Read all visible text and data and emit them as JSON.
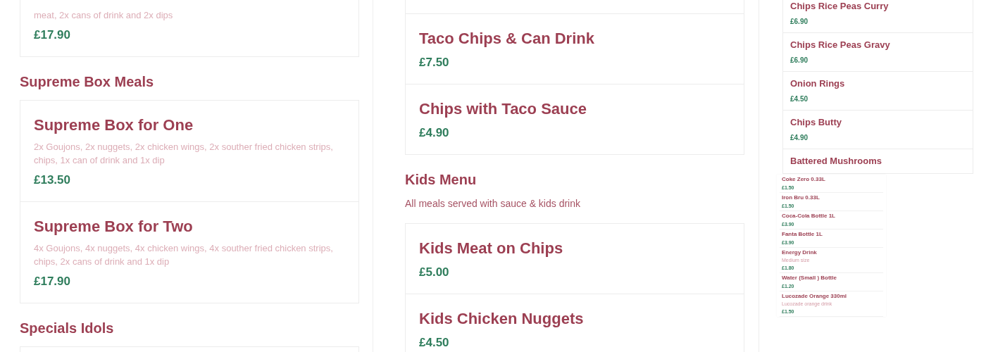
{
  "columns": [
    {
      "blocks": [
        {
          "kind": "item",
          "description": "meat, 2x cans of drink and 2x dips",
          "price": "£17.90"
        },
        {
          "kind": "heading",
          "title": "Supreme Box Meals"
        },
        {
          "kind": "item",
          "name": "Supreme Box for One",
          "description": "2x Goujons, 2x nuggets, 2x chicken wings, 2x souther fried chicken strips, chips, 1x can of drink and 1x dip",
          "price": "£13.50"
        },
        {
          "kind": "item",
          "name": "Supreme Box for Two",
          "description": "4x Goujons, 4x nuggets, 4x chicken wings, 4x souther fried chicken strips, chips, 2x cans of drink and 1x dip",
          "price": "£17.90"
        },
        {
          "kind": "heading",
          "title": "Specials Idols"
        },
        {
          "kind": "stub"
        }
      ]
    },
    {
      "blocks": [
        {
          "kind": "stub"
        },
        {
          "kind": "item",
          "name": "Taco Chips & Can Drink",
          "price": "£7.50"
        },
        {
          "kind": "item",
          "name": "Chips with Taco Sauce",
          "price": "£4.90"
        },
        {
          "kind": "heading",
          "title": "Kids Menu"
        },
        {
          "kind": "note",
          "text": "All meals served with sauce & kids drink"
        },
        {
          "kind": "item",
          "name": "Kids Meat on Chips",
          "price": "£5.00"
        },
        {
          "kind": "item",
          "name": "Kids Chicken Nuggets",
          "price": "£4.50"
        }
      ]
    },
    {
      "blocks": [
        {
          "kind": "item",
          "name": "Chips Rice Peas Curry",
          "price": "£6.90"
        },
        {
          "kind": "item",
          "name": "Chips Rice Peas Gravy",
          "price": "£6.90"
        },
        {
          "kind": "item",
          "name": "Onion Rings",
          "price": "£4.50"
        },
        {
          "kind": "item",
          "name": "Chips Butty",
          "price": "£4.90"
        },
        {
          "kind": "item",
          "name": "Battered Mushrooms"
        }
      ]
    }
  ],
  "drinks_overlay": [
    {
      "name": "Coke Zero 0.33L",
      "price": "£1.50"
    },
    {
      "name": "Iron Bru 0.33L",
      "price": "£1.50"
    },
    {
      "name": "Coca-Cola Bottle 1L",
      "price": "£3.90"
    },
    {
      "name": "Fanta Bottle 1L",
      "price": "£3.90"
    },
    {
      "name": "Energy Drink",
      "description": "Medium size",
      "price": "£1.80"
    },
    {
      "name": "Water (Small ) Bottle",
      "price": "£1.20"
    },
    {
      "name": "Lucozade Orange 330ml",
      "description": "Lucozade orange drink",
      "price": "£1.50"
    }
  ]
}
